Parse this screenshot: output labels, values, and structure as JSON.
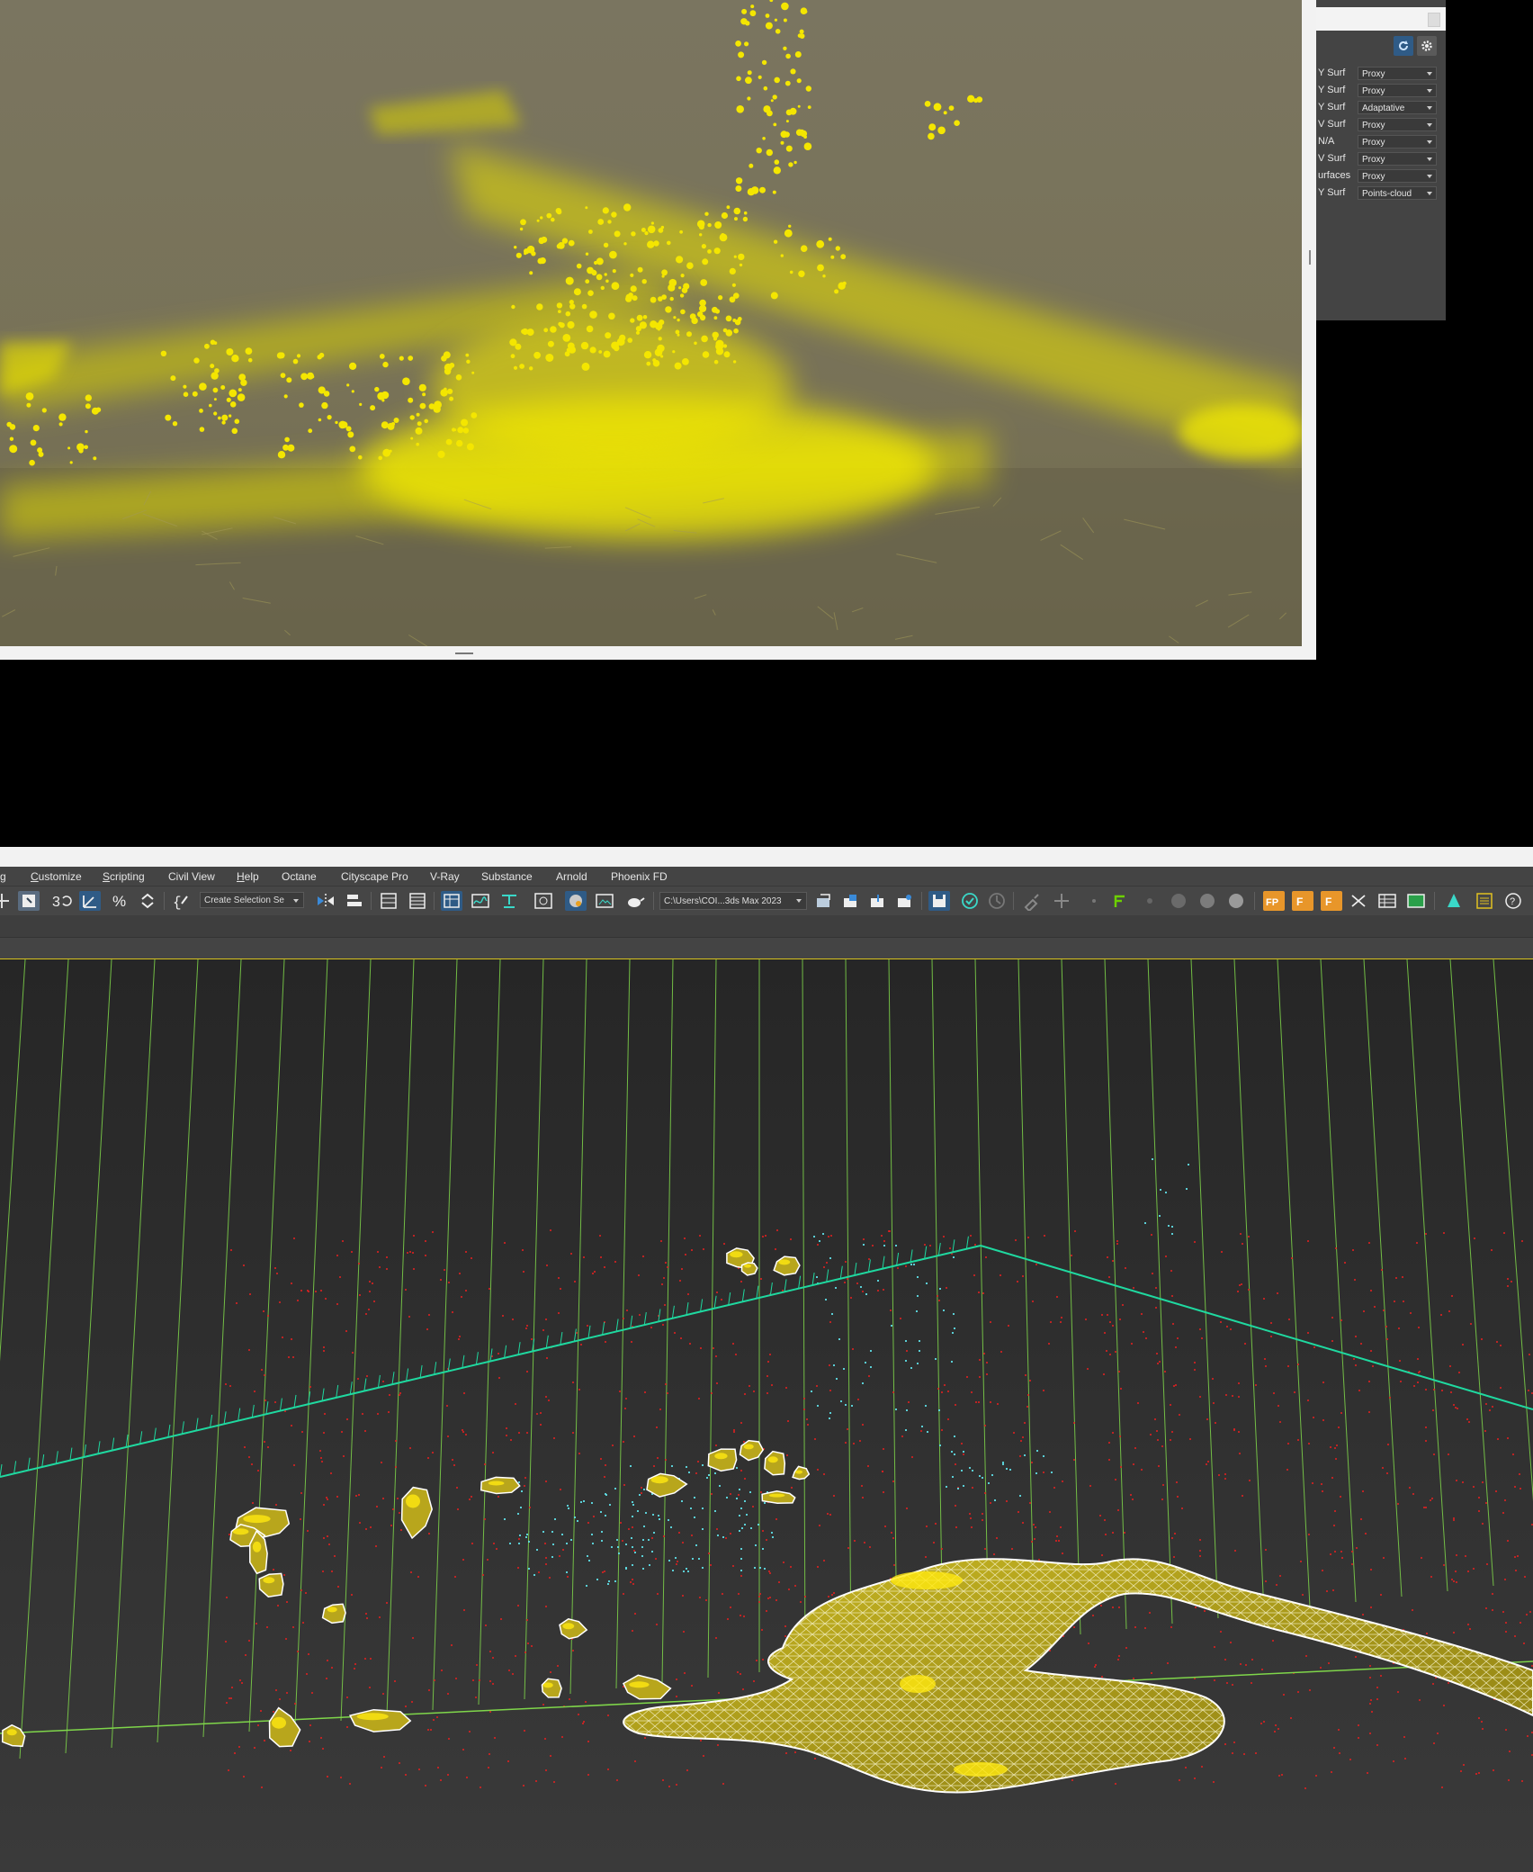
{
  "side_panel": {
    "rows": [
      {
        "label": "Y Surf",
        "value": "Proxy"
      },
      {
        "label": "Y Surf",
        "value": "Proxy"
      },
      {
        "label": "Y Surf",
        "value": "Adaptative"
      },
      {
        "label": "V Surf",
        "value": "Proxy"
      },
      {
        "label": "N/A",
        "value": "Proxy"
      },
      {
        "label": "V Surf",
        "value": "Proxy"
      },
      {
        "label": "urfaces",
        "value": "Proxy"
      },
      {
        "label": "Y Surf",
        "value": "Points-cloud"
      }
    ],
    "icons": [
      "refresh-icon",
      "gear-icon"
    ]
  },
  "menu": {
    "items": [
      {
        "label": "g"
      },
      {
        "mnemonic": "C",
        "rest": "ustomize"
      },
      {
        "mnemonic": "S",
        "rest": "cripting"
      },
      {
        "label": "Civil View"
      },
      {
        "mnemonic": "H",
        "rest": "elp"
      },
      {
        "label": "Octane"
      },
      {
        "label": "Cityscape Pro"
      },
      {
        "label": "V-Ray"
      },
      {
        "label": "Substance"
      },
      {
        "label": "Arnold"
      },
      {
        "label": "Phoenix FD"
      }
    ]
  },
  "toolbar": {
    "selection_set": "Create Selection Se",
    "project_path": "C:\\Users\\COI...3ds Max 2023",
    "labels": {
      "fp1": "FP",
      "fp2": "F",
      "fp3": "F"
    }
  },
  "colors": {
    "accent_yellow": "#f4e600",
    "grid_green": "#7fd64a",
    "axis_teal": "#1fd9a0",
    "particle_red": "#e02020",
    "particle_cyan": "#5fe0e8",
    "viewport_bg": "#2c2c2c"
  }
}
